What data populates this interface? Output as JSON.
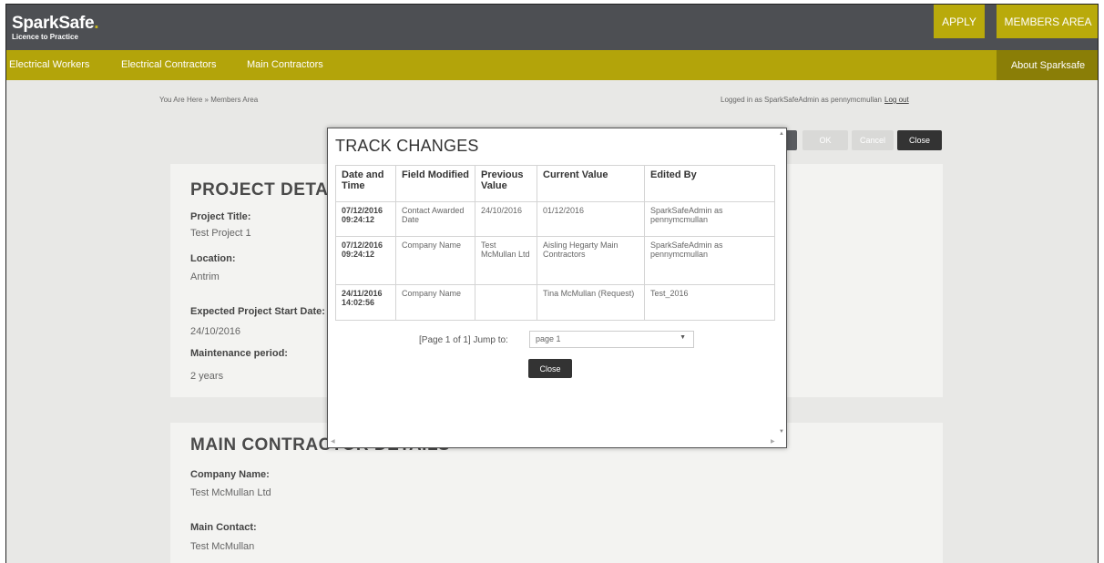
{
  "brand": {
    "name_spark": "Spark",
    "name_safe": "Safe",
    "dot": ".",
    "tagline": "Licence to Practice"
  },
  "header": {
    "apply": "APPLY",
    "members_area": "MEMBERS AREA",
    "about": "About Sparksafe"
  },
  "nav": [
    "Electrical Workers",
    "Electrical Contractors",
    "Main Contractors"
  ],
  "breadcrumb": "You Are Here » Members Area",
  "login": {
    "text": "Logged in as SparkSafeAdmin as pennymcmullan",
    "logout": "Log out"
  },
  "actions": {
    "ok": "OK",
    "cancel": "Cancel",
    "close": "Close"
  },
  "project": {
    "heading": "PROJECT DETAILS",
    "title_label": "Project Title:",
    "title_value": "Test Project 1",
    "location_label": "Location:",
    "location_value": "Antrim",
    "start_label": "Expected Project Start Date:",
    "start_value": "24/10/2016",
    "maintenance_label": "Maintenance period:",
    "maintenance_value": "2 years"
  },
  "contractor": {
    "heading": "MAIN CONTRACTOR DETAILS",
    "company_label": "Company Name:",
    "company_value": "Test McMullan Ltd",
    "contact_label": "Main Contact:",
    "contact_value": "Test McMullan"
  },
  "modal": {
    "title": "TRACK CHANGES",
    "columns": [
      "Date and Time",
      "Field Modified",
      "Previous Value",
      "Current Value",
      "Edited By"
    ],
    "rows": [
      {
        "date": "07/12/2016",
        "time": "09:24:12",
        "field": "Contact Awarded Date",
        "previous": "24/10/2016",
        "current": "01/12/2016",
        "edited_by": "SparkSafeAdmin as pennymcmullan"
      },
      {
        "date": "07/12/2016",
        "time": "09:24:12",
        "field": "Company Name",
        "previous": "Test McMullan Ltd",
        "current": "Aisling Hegarty Main Contractors",
        "edited_by": "SparkSafeAdmin as pennymcmullan"
      },
      {
        "date": "24/11/2016",
        "time": "14:02:56",
        "field": "Company Name",
        "previous": "",
        "current": "Tina McMullan (Request)",
        "edited_by": "Test_2016"
      }
    ],
    "pager_text": "[Page 1 of 1] Jump to:",
    "page_select_value": "page 1",
    "close": "Close"
  },
  "colors": {
    "header": "#4d4f53",
    "accent": "#b3a40a",
    "accent_dark": "#8a7e07",
    "content_bg": "#e8e8e6"
  },
  "icons": {
    "select": "chevron-down-icon",
    "scroll": "scroll-arrow-icon"
  }
}
